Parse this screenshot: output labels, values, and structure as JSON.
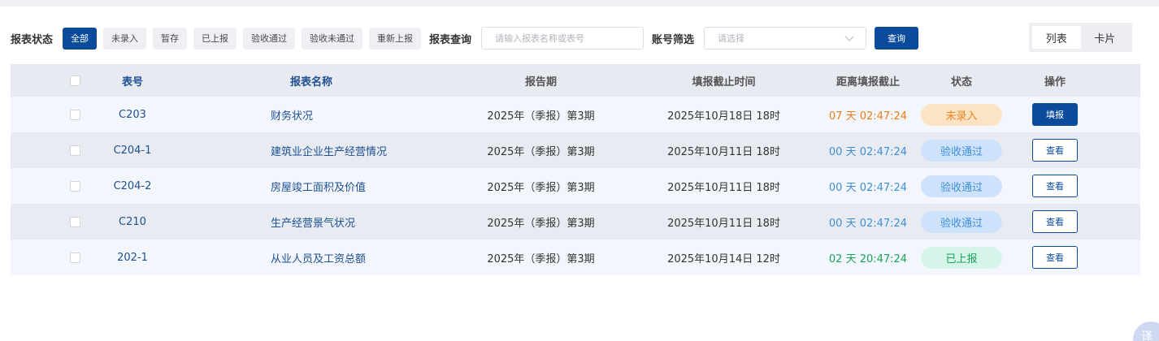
{
  "filters": {
    "status_label": "报表状态",
    "chips": [
      {
        "label": "全部",
        "active": true
      },
      {
        "label": "未录入",
        "active": false
      },
      {
        "label": "暂存",
        "active": false
      },
      {
        "label": "已上报",
        "active": false
      },
      {
        "label": "验收通过",
        "active": false
      },
      {
        "label": "验收未通过",
        "active": false
      },
      {
        "label": "重新上报",
        "active": false
      }
    ],
    "query_label": "报表查询",
    "query_placeholder": "请输入报表名称或表号",
    "account_label": "账号筛选",
    "account_placeholder": "请选择",
    "query_button": "查询"
  },
  "view_switch": {
    "list_label": "列表",
    "card_label": "卡片",
    "active": "list"
  },
  "table": {
    "headers": {
      "code": "表号",
      "name": "报表名称",
      "period": "报告期",
      "deadline": "填报截止时间",
      "remaining": "距离填报截止",
      "status": "状态",
      "action": "操作"
    },
    "rows": [
      {
        "code": "C203",
        "name": "财务状况",
        "period": "2025年（季报）第3期",
        "deadline": "2025年10月18日 18时",
        "remaining": "07 天 02:47:24",
        "status": "未录入",
        "status_color": "orange",
        "action": "填报",
        "action_style": "fill"
      },
      {
        "code": "C204-1",
        "name": "建筑业企业生产经营情况",
        "period": "2025年（季报）第3期",
        "deadline": "2025年10月11日 18时",
        "remaining": "00 天 02:47:24",
        "status": "验收通过",
        "status_color": "blue",
        "action": "查看",
        "action_style": "outline"
      },
      {
        "code": "C204-2",
        "name": "房屋竣工面积及价值",
        "period": "2025年（季报）第3期",
        "deadline": "2025年10月11日 18时",
        "remaining": "00 天 02:47:24",
        "status": "验收通过",
        "status_color": "blue",
        "action": "查看",
        "action_style": "outline"
      },
      {
        "code": "C210",
        "name": "生产经营景气状况",
        "period": "2025年（季报）第3期",
        "deadline": "2025年10月11日 18时",
        "remaining": "00 天 02:47:24",
        "status": "验收通过",
        "status_color": "blue",
        "action": "查看",
        "action_style": "outline"
      },
      {
        "code": "202-1",
        "name": "从业人员及工资总额",
        "period": "2025年（季报）第3期",
        "deadline": "2025年10月14日 12时",
        "remaining": "02 天 20:47:24",
        "status": "已上报",
        "status_color": "green",
        "action": "查看",
        "action_style": "outline"
      }
    ]
  },
  "corner_widget": {
    "glyph": "译"
  },
  "colors": {
    "primary": "#0b4b9c",
    "orange": "#f07d17",
    "blue": "#3f8fd8",
    "green": "#18a558"
  }
}
